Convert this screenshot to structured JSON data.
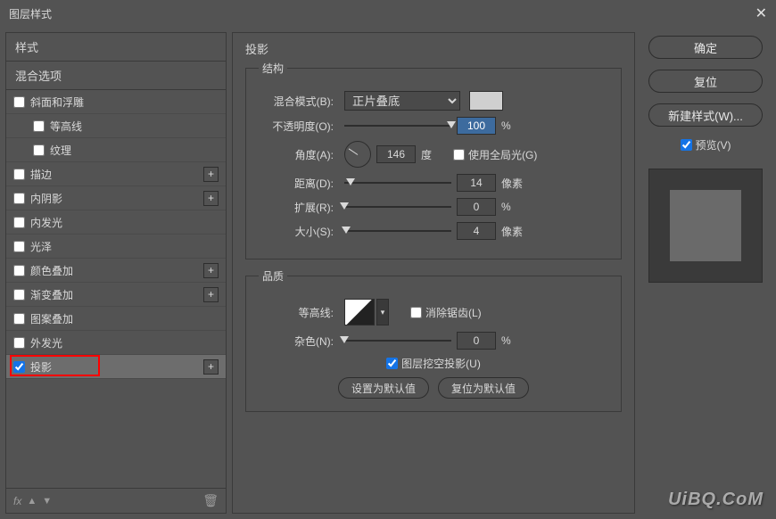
{
  "title": "图层样式",
  "sidebar": {
    "header1": "样式",
    "header2": "混合选项",
    "items": [
      {
        "label": "斜面和浮雕",
        "checked": false,
        "plus": false,
        "indent": false
      },
      {
        "label": "等高线",
        "checked": false,
        "plus": false,
        "indent": true
      },
      {
        "label": "纹理",
        "checked": false,
        "plus": false,
        "indent": true
      },
      {
        "label": "描边",
        "checked": false,
        "plus": true,
        "indent": false
      },
      {
        "label": "内阴影",
        "checked": false,
        "plus": true,
        "indent": false
      },
      {
        "label": "内发光",
        "checked": false,
        "plus": false,
        "indent": false
      },
      {
        "label": "光泽",
        "checked": false,
        "plus": false,
        "indent": false
      },
      {
        "label": "颜色叠加",
        "checked": false,
        "plus": true,
        "indent": false
      },
      {
        "label": "渐变叠加",
        "checked": false,
        "plus": true,
        "indent": false
      },
      {
        "label": "图案叠加",
        "checked": false,
        "plus": false,
        "indent": false
      },
      {
        "label": "外发光",
        "checked": false,
        "plus": false,
        "indent": false
      },
      {
        "label": "投影",
        "checked": true,
        "plus": true,
        "indent": false,
        "selected": true,
        "highlight": true
      }
    ],
    "fx": "fx"
  },
  "center": {
    "title": "投影",
    "structure_legend": "结构",
    "blend_mode_label": "混合模式(B):",
    "blend_mode_value": "正片叠底",
    "opacity_label": "不透明度(O):",
    "opacity_value": "100",
    "opacity_unit": "%",
    "angle_label": "角度(A):",
    "angle_value": "146",
    "angle_unit": "度",
    "global_light_label": "使用全局光(G)",
    "distance_label": "距离(D):",
    "distance_value": "14",
    "distance_unit": "像素",
    "spread_label": "扩展(R):",
    "spread_value": "0",
    "spread_unit": "%",
    "size_label": "大小(S):",
    "size_value": "4",
    "size_unit": "像素",
    "quality_legend": "品质",
    "contour_label": "等高线:",
    "antialias_label": "消除锯齿(L)",
    "noise_label": "杂色(N):",
    "noise_value": "0",
    "noise_unit": "%",
    "knockout_label": "图层挖空投影(U)",
    "default_btn": "设置为默认值",
    "reset_btn": "复位为默认值"
  },
  "right": {
    "ok": "确定",
    "cancel": "复位",
    "new_style": "新建样式(W)...",
    "preview_label": "预览(V)"
  },
  "watermark": "UiBQ.CoM"
}
